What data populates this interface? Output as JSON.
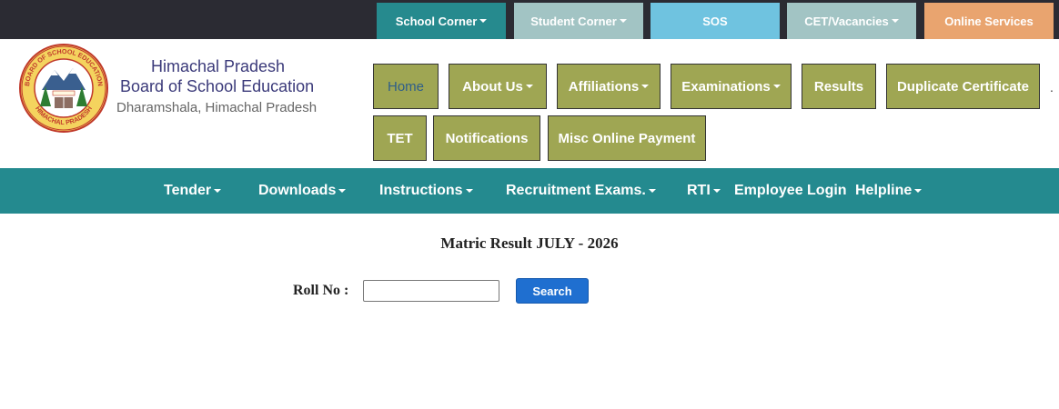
{
  "topbar": {
    "items": [
      {
        "label": "School Corner",
        "color": "#268a8e"
      },
      {
        "label": "Student Corner",
        "color": "#a2c4c4"
      },
      {
        "label": "SOS",
        "color": "#6fc3e0"
      },
      {
        "label": "CET/Vacancies",
        "color": "#a2c4c4"
      },
      {
        "label": "Online Services",
        "color": "#e9a46f"
      }
    ]
  },
  "brand": {
    "line1": "Himachal Pradesh",
    "line2": "Board of School Education",
    "line3": "Dharamshala, Himachal Pradesh",
    "logo_ring_top": "BOARD OF SCHOOL EDUCATION",
    "logo_ring_bottom": "HIMACHAL PRADESH"
  },
  "mainnav": {
    "items": [
      {
        "label": "Home"
      },
      {
        "label": "About Us "
      },
      {
        "label": "Affiliations"
      },
      {
        "label": "Examinations"
      },
      {
        "label": "Results"
      },
      {
        "label": "Duplicate Certificate"
      },
      {
        "label": "TET"
      },
      {
        "label": "Notifications"
      },
      {
        "label": "Misc Online Payment"
      }
    ],
    "trailing_dot": "."
  },
  "secondnav": {
    "items": [
      {
        "label": "Tender"
      },
      {
        "label": "Downloads"
      },
      {
        "label": "Instructions"
      },
      {
        "label": "Recruitment Exams."
      },
      {
        "label": "RTI"
      },
      {
        "label": "Employee Login"
      },
      {
        "label": "Helpline"
      }
    ]
  },
  "result": {
    "title": "Matric Result JULY - 2026",
    "roll_label": "Roll No :",
    "roll_value": "",
    "search_label": "Search"
  },
  "colors": {
    "nav_green": "#9fa653",
    "teal": "#248a8f",
    "topbar_bg": "#2b2b33",
    "search_blue": "#1f6fd0"
  }
}
